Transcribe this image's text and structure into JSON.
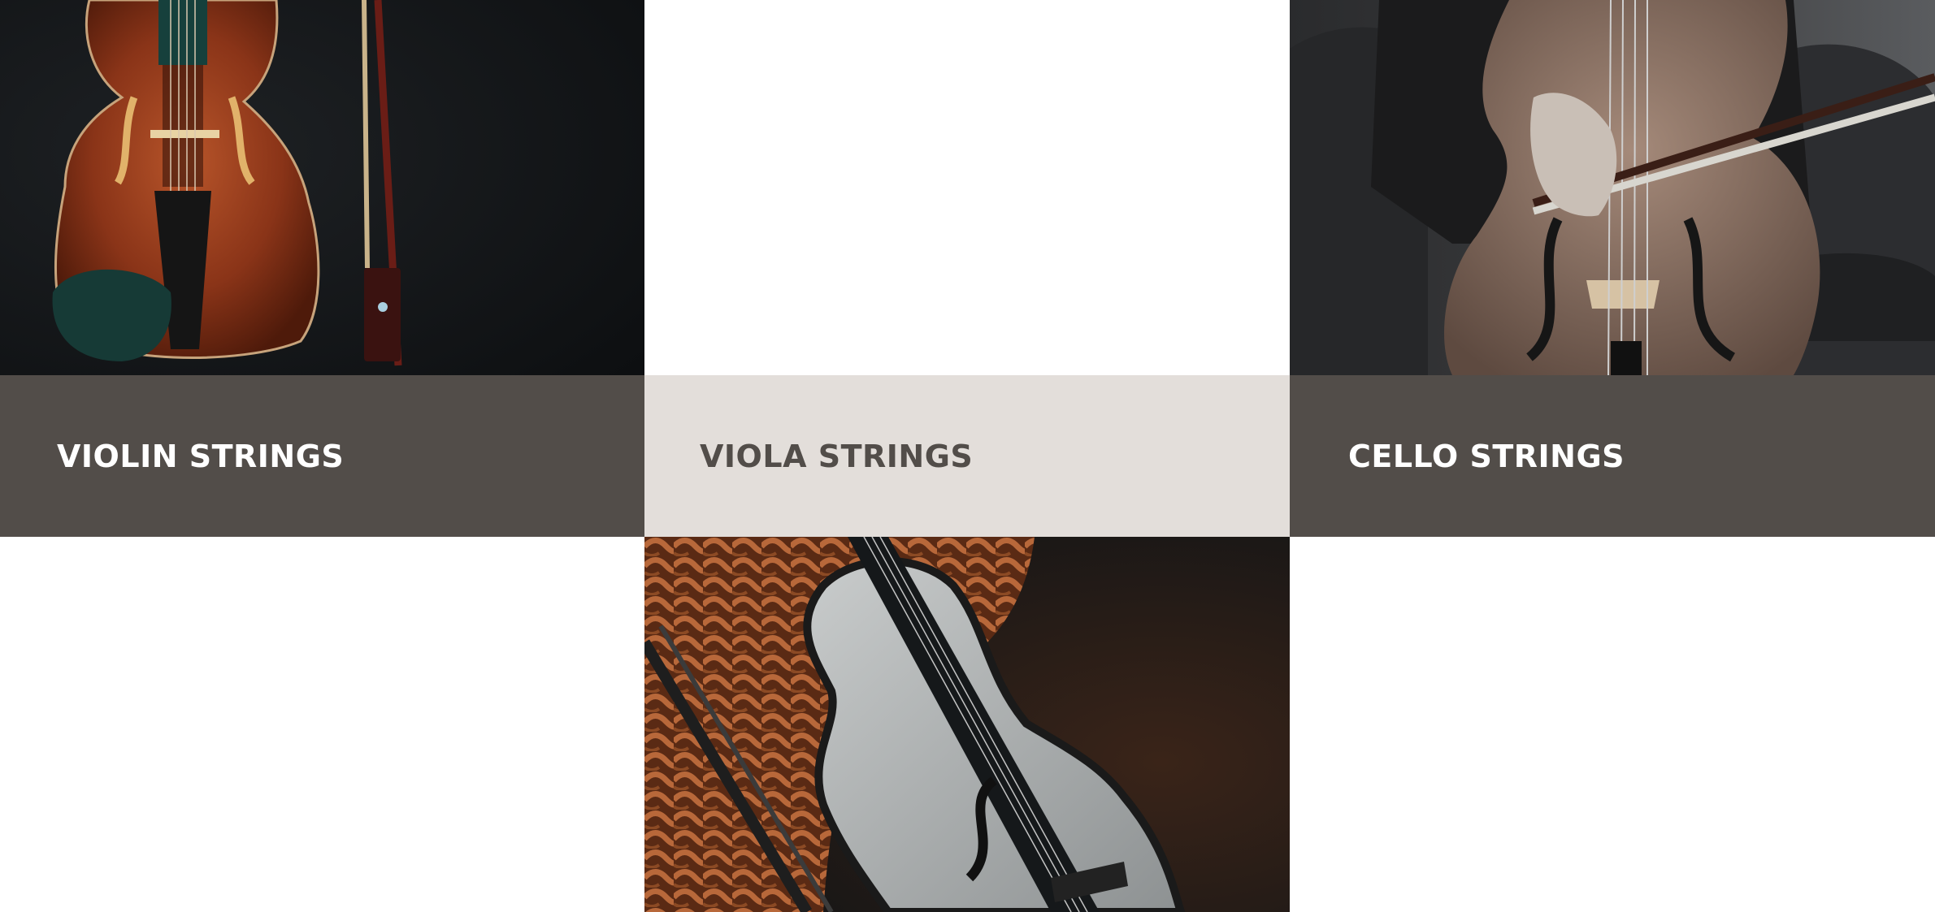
{
  "categories": [
    {
      "id": "violin",
      "title": "VIOLIN STRINGS",
      "band_color": "#524d49",
      "text_color": "#ffffff",
      "image": "violin-photo"
    },
    {
      "id": "viola",
      "title": "VIOLA STRINGS",
      "band_color": "#e3deda",
      "text_color": "#524d49",
      "image": "viola-photo"
    },
    {
      "id": "cello",
      "title": "CELLO STRINGS",
      "band_color": "#524d49",
      "text_color": "#ffffff",
      "image": "cello-photo"
    }
  ]
}
